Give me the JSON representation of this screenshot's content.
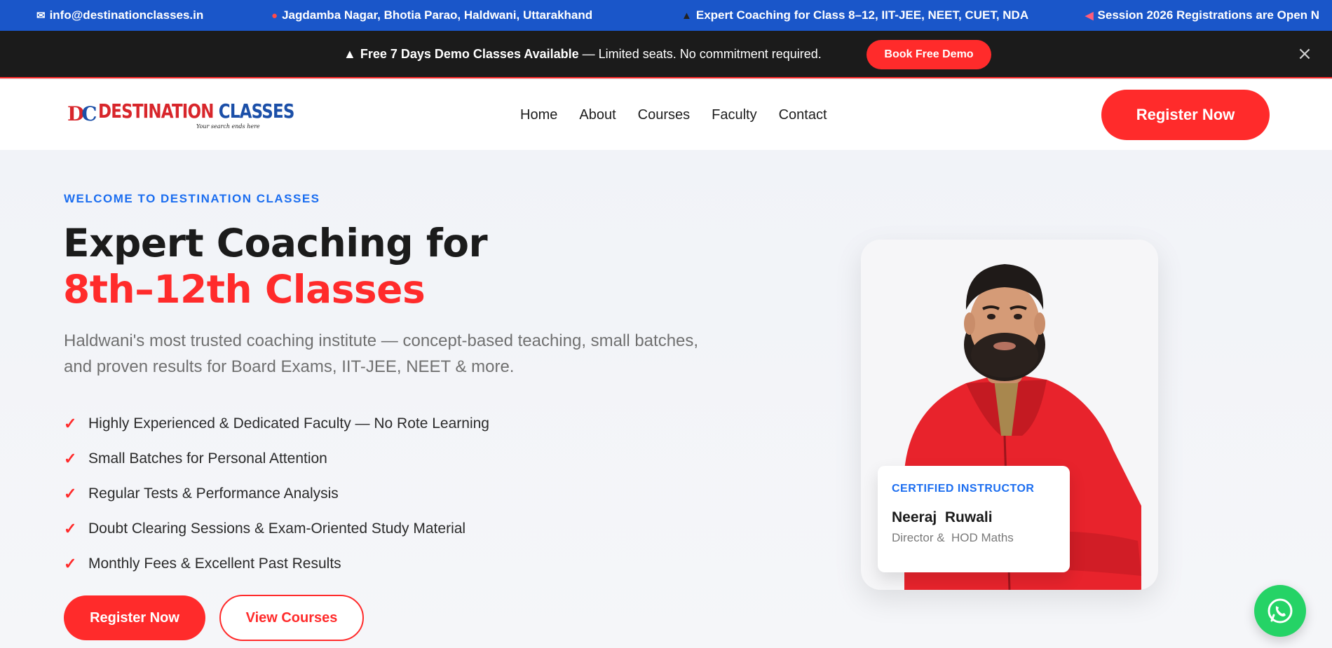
{
  "ticker": {
    "email": "info@destinationclasses.in",
    "address": "Jagdamba Nagar, Bhotia Parao, Haldwani, Uttarakhand",
    "coaching": "Expert Coaching for Class 8–12, IIT-JEE, NEET, CUET, NDA",
    "session": "Session 2026 Registrations are Open N"
  },
  "promo": {
    "bold_text": "Free 7 Days Demo Classes Available",
    "rest_text": " — Limited seats. No commitment required.",
    "button_label": "Book Free Demo"
  },
  "header": {
    "logo_mark_d": "D",
    "logo_mark_c": "C",
    "logo_word1": "DESTINATION",
    "logo_word2": "CLASSES",
    "logo_tagline": "Your search ends here",
    "nav": [
      "Home",
      "About",
      "Courses",
      "Faculty",
      "Contact"
    ],
    "cta_label": "Register Now"
  },
  "hero": {
    "eyebrow": "WELCOME TO DESTINATION CLASSES",
    "title_line1": "Expert Coaching for",
    "title_line2": "8th–12th Classes",
    "lead": "Haldwani's most trusted coaching institute — concept-based teaching, small batches, and proven results for Board Exams, IIT-JEE, NEET & more.",
    "check_glyph": "✓",
    "features": [
      "Highly Experienced & Dedicated Faculty — No Rote Learning",
      "Small Batches for Personal Attention",
      "Regular Tests & Performance Analysis",
      "Doubt Clearing Sessions & Exam-Oriented Study Material",
      "Monthly Fees & Excellent Past Results"
    ],
    "primary_button": "Register Now",
    "secondary_button": "View Courses"
  },
  "instructor": {
    "badge": "CERTIFIED INSTRUCTOR",
    "name": "Neeraj  Ruwali",
    "role": "Director &  HOD Maths"
  },
  "icons": {
    "mail": "mail-icon",
    "pin": "map-pin-icon",
    "cap": "graduation-cap-icon",
    "megaphone": "megaphone-icon",
    "close": "close-icon",
    "whatsapp": "whatsapp-icon"
  },
  "colors": {
    "ticker_bg": "#1a56c9",
    "promo_bg": "#1b1b1b",
    "accent_red": "#ff2b2b",
    "accent_blue": "#1c6ef0",
    "whatsapp_green": "#25d366"
  }
}
